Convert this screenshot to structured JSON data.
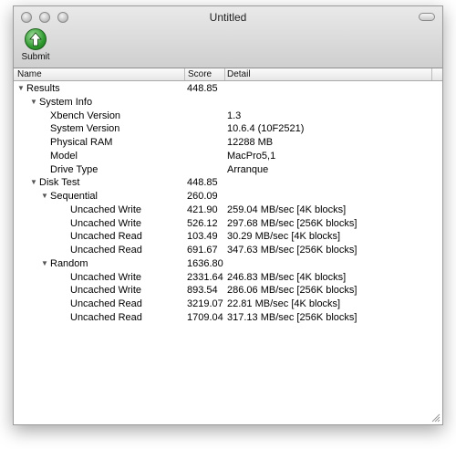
{
  "window": {
    "title": "Untitled"
  },
  "toolbar": {
    "submit_label": "Submit"
  },
  "columns": {
    "name": "Name",
    "score": "Score",
    "detail": "Detail"
  },
  "rows": [
    {
      "name": "Results",
      "score": "448.85",
      "detail": "",
      "level": 0,
      "expanded": true
    },
    {
      "name": "System Info",
      "score": "",
      "detail": "",
      "level": 1,
      "expanded": true
    },
    {
      "name": "Xbench Version",
      "score": "",
      "detail": "1.3",
      "level": 2
    },
    {
      "name": "System Version",
      "score": "",
      "detail": "10.6.4 (10F2521)",
      "level": 2
    },
    {
      "name": "Physical RAM",
      "score": "",
      "detail": "12288 MB",
      "level": 2
    },
    {
      "name": "Model",
      "score": "",
      "detail": "MacPro5,1",
      "level": 2
    },
    {
      "name": "Drive Type",
      "score": "",
      "detail": "Arranque",
      "level": 2
    },
    {
      "name": "Disk Test",
      "score": "448.85",
      "detail": "",
      "level": 1,
      "expanded": true
    },
    {
      "name": "Sequential",
      "score": "260.09",
      "detail": "",
      "level": 2,
      "expanded": true
    },
    {
      "name": "Uncached Write",
      "score": "421.90",
      "detail": "259.04 MB/sec [4K blocks]",
      "level": 3
    },
    {
      "name": "Uncached Write",
      "score": "526.12",
      "detail": "297.68 MB/sec [256K blocks]",
      "level": 3
    },
    {
      "name": "Uncached Read",
      "score": "103.49",
      "detail": "30.29 MB/sec [4K blocks]",
      "level": 3
    },
    {
      "name": "Uncached Read",
      "score": "691.67",
      "detail": "347.63 MB/sec [256K blocks]",
      "level": 3
    },
    {
      "name": "Random",
      "score": "1636.80",
      "detail": "",
      "level": 2,
      "expanded": true
    },
    {
      "name": "Uncached Write",
      "score": "2331.64",
      "detail": "246.83 MB/sec [4K blocks]",
      "level": 3
    },
    {
      "name": "Uncached Write",
      "score": "893.54",
      "detail": "286.06 MB/sec [256K blocks]",
      "level": 3
    },
    {
      "name": "Uncached Read",
      "score": "3219.07",
      "detail": "22.81 MB/sec [4K blocks]",
      "level": 3
    },
    {
      "name": "Uncached Read",
      "score": "1709.04",
      "detail": "317.13 MB/sec [256K blocks]",
      "level": 3
    }
  ]
}
